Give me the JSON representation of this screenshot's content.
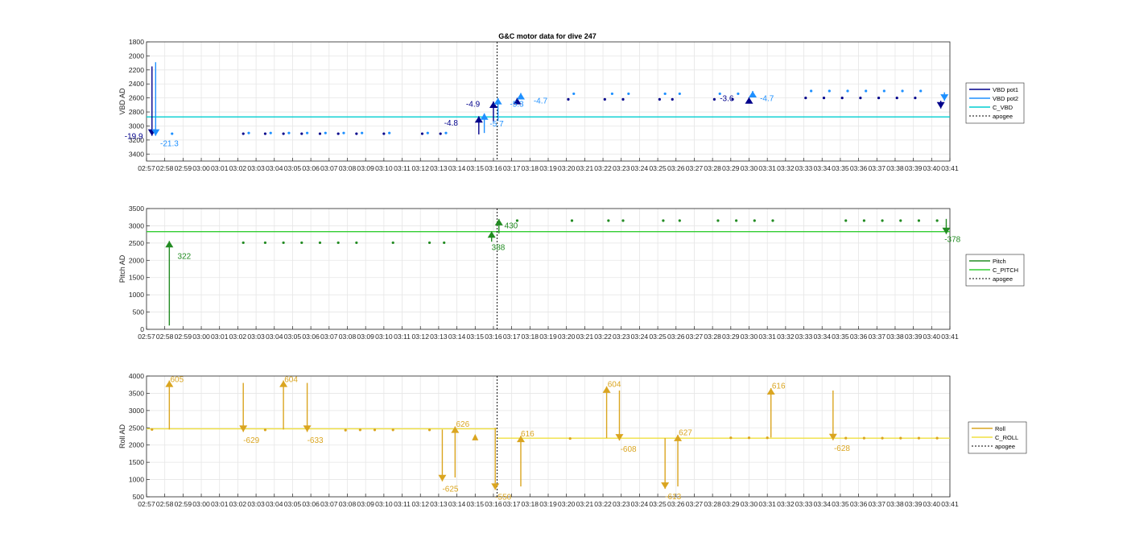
{
  "figure_title": "G&C motor data for dive 247",
  "time_ticks": [
    "02:57",
    "02:58",
    "02:59",
    "03:00",
    "03:01",
    "03:02",
    "03:03",
    "03:04",
    "03:05",
    "03:06",
    "03:07",
    "03:08",
    "03:09",
    "03:10",
    "03:11",
    "03:12",
    "03:13",
    "03:14",
    "03:15",
    "03:16",
    "03:17",
    "03:18",
    "03:19",
    "03:20",
    "03:21",
    "03:22",
    "03:23",
    "03:24",
    "03:25",
    "03:26",
    "03:27",
    "03:28",
    "03:29",
    "03:30",
    "03:31",
    "03:32",
    "03:33",
    "03:34",
    "03:35",
    "03:36",
    "03:37",
    "03:38",
    "03:39",
    "03:40",
    "03:41"
  ],
  "colors": {
    "vbd_pot1": "#00008b",
    "vbd_pot2": "#1e90ff",
    "c_vbd": "#00ced1",
    "pitch": "#228b22",
    "c_pitch": "#32cd32",
    "roll": "#daa520",
    "c_roll": "#f0e040",
    "apogee": "#000000",
    "grid": "#e6e6e6",
    "axis": "#262626"
  },
  "chart_data": [
    {
      "type": "line",
      "title": "G&C motor data for dive 247",
      "ylabel": "VBD AD",
      "xlabel": "",
      "ylim": [
        1800,
        3500
      ],
      "y_reversed": true,
      "yticks": [
        1800,
        2000,
        2200,
        2400,
        2600,
        2800,
        3000,
        3200,
        3400
      ],
      "xlim": [
        0,
        44
      ],
      "grid": true,
      "legend_position": "right",
      "legend": [
        "VBD pot1",
        "VBD pot2",
        "C_VBD",
        "apogee"
      ],
      "apogee_x": 19.2,
      "series": [
        {
          "name": "VBD pot1",
          "color": "#00008b",
          "marker_only": true,
          "x": [
            5.3,
            6.5,
            7.5,
            8.5,
            9.5,
            10.5,
            11.5,
            13.0,
            15.1,
            16.1,
            23.1,
            25.1,
            26.1,
            28.1,
            28.8,
            31.1,
            32.1,
            36.1,
            37.1,
            38.1,
            39.1,
            40.1,
            41.1,
            42.1
          ],
          "y": [
            3110,
            3110,
            3110,
            3110,
            3110,
            3110,
            3110,
            3110,
            3110,
            3110,
            2620,
            2620,
            2620,
            2620,
            2620,
            2620,
            2620,
            2600,
            2600,
            2600,
            2600,
            2600,
            2600,
            2600
          ]
        },
        {
          "name": "VBD pot2",
          "color": "#1e90ff",
          "marker_only": true,
          "x": [
            1.4,
            5.6,
            6.8,
            7.8,
            8.8,
            9.8,
            10.8,
            11.8,
            13.3,
            15.4,
            16.4,
            23.4,
            25.5,
            26.4,
            28.4,
            29.2,
            31.4,
            32.4,
            36.4,
            37.4,
            38.4,
            39.4,
            40.4,
            41.4,
            42.4
          ],
          "y": [
            3110,
            3100,
            3100,
            3100,
            3100,
            3100,
            3100,
            3100,
            3100,
            3100,
            3100,
            2540,
            2540,
            2540,
            2540,
            2540,
            2540,
            2540,
            2500,
            2500,
            2500,
            2500,
            2500,
            2500,
            2500
          ]
        },
        {
          "name": "C_VBD",
          "color": "#00ced1",
          "constant_y": 2870
        }
      ],
      "moves": [
        {
          "x": 0.3,
          "from": 2150,
          "to": 3140,
          "color": "#00008b"
        },
        {
          "x": 0.5,
          "from": 2090,
          "to": 3140,
          "color": "#1e90ff"
        },
        {
          "x": 18.2,
          "from": 3120,
          "to": 2860,
          "color": "#00008b"
        },
        {
          "x": 18.5,
          "from": 3100,
          "to": 2820,
          "color": "#1e90ff"
        },
        {
          "x": 19.0,
          "from": 2940,
          "to": 2650,
          "color": "#00008b"
        },
        {
          "x": 19.25,
          "from": 2930,
          "to": 2600,
          "color": "#1e90ff"
        },
        {
          "x": 20.3,
          "from": 2650,
          "to": 2600,
          "color": "#00008b"
        },
        {
          "x": 20.5,
          "from": 2600,
          "to": 2530,
          "color": "#1e90ff"
        },
        {
          "x": 33.0,
          "from": 2620,
          "to": 2590,
          "color": "#00008b"
        },
        {
          "x": 33.2,
          "from": 2560,
          "to": 2500,
          "color": "#1e90ff"
        },
        {
          "x": 43.5,
          "from": 2640,
          "to": 2750,
          "color": "#00008b"
        },
        {
          "x": 43.7,
          "from": 2520,
          "to": 2640,
          "color": "#1e90ff"
        }
      ],
      "annotations": [
        {
          "text": "-19.9",
          "x": -1.2,
          "y": 3140,
          "color": "#00008b"
        },
        {
          "text": "-21.3",
          "x": 0.75,
          "y": 3240,
          "color": "#1e90ff"
        },
        {
          "text": "-4.8",
          "x": 16.3,
          "y": 2950,
          "color": "#00008b"
        },
        {
          "text": "-5.7",
          "x": 18.8,
          "y": 2960,
          "color": "#1e90ff"
        },
        {
          "text": "-4.9",
          "x": 17.5,
          "y": 2680,
          "color": "#00008b"
        },
        {
          "text": "-5.3",
          "x": 19.9,
          "y": 2680,
          "color": "#1e90ff"
        },
        {
          "text": "-4.7",
          "x": 21.2,
          "y": 2630,
          "color": "#1e90ff"
        },
        {
          "text": "-3.6",
          "x": 31.4,
          "y": 2600,
          "color": "#00008b"
        },
        {
          "text": "-4.7",
          "x": 33.6,
          "y": 2600,
          "color": "#1e90ff"
        }
      ]
    },
    {
      "type": "line",
      "title": "",
      "ylabel": "Pitch AD",
      "xlabel": "",
      "ylim": [
        0,
        3500
      ],
      "yticks": [
        0,
        500,
        1000,
        1500,
        2000,
        2500,
        3000,
        3500
      ],
      "xlim": [
        0,
        44
      ],
      "grid": true,
      "legend_position": "right",
      "legend": [
        "Pitch",
        "C_PITCH",
        "apogee"
      ],
      "apogee_x": 19.2,
      "series": [
        {
          "name": "Pitch",
          "color": "#228b22",
          "marker_only": true,
          "x": [
            5.3,
            6.5,
            7.5,
            8.5,
            9.5,
            10.5,
            11.5,
            13.5,
            15.5,
            16.3,
            20.3,
            23.3,
            25.3,
            26.1,
            28.3,
            29.2,
            31.3,
            32.3,
            33.3,
            34.3,
            38.3,
            39.3,
            40.3,
            41.3,
            42.3,
            43.3
          ],
          "y": [
            2510,
            2510,
            2510,
            2510,
            2510,
            2510,
            2510,
            2510,
            2510,
            2510,
            3150,
            3150,
            3150,
            3150,
            3150,
            3150,
            3150,
            3150,
            3150,
            3150,
            3150,
            3150,
            3150,
            3150,
            3150,
            3150
          ]
        },
        {
          "name": "C_PITCH",
          "color": "#32cd32",
          "constant_y": 2830
        }
      ],
      "moves": [
        {
          "x": 1.25,
          "from": 110,
          "to": 2560,
          "color": "#228b22"
        },
        {
          "x": 18.9,
          "from": 2540,
          "to": 2840,
          "color": "#228b22"
        },
        {
          "x": 19.3,
          "from": 2780,
          "to": 3200,
          "color": "#228b22"
        },
        {
          "x": 43.8,
          "from": 3200,
          "to": 2760,
          "color": "#228b22"
        }
      ],
      "annotations": [
        {
          "text": "322",
          "x": 1.7,
          "y": 2130,
          "color": "#228b22"
        },
        {
          "text": "388",
          "x": 18.9,
          "y": 2390,
          "color": "#228b22"
        },
        {
          "text": "430",
          "x": 19.6,
          "y": 3020,
          "color": "#228b22"
        },
        {
          "text": "-378",
          "x": 43.7,
          "y": 2620,
          "color": "#228b22"
        }
      ]
    },
    {
      "type": "line",
      "title": "",
      "ylabel": "Roll AD",
      "xlabel": "",
      "ylim": [
        500,
        4000
      ],
      "yticks": [
        500,
        1000,
        1500,
        2000,
        2500,
        3000,
        3500,
        4000
      ],
      "xlim": [
        0,
        44
      ],
      "grid": true,
      "legend_position": "right",
      "legend": [
        "Roll",
        "C_ROLL",
        "apogee"
      ],
      "apogee_x": 19.2,
      "series": [
        {
          "name": "Roll",
          "color": "#daa520",
          "marker_only": true,
          "x": [
            0.3,
            6.5,
            10.9,
            11.7,
            12.5,
            13.5,
            15.5,
            23.2,
            32.0,
            33.0,
            34.0,
            38.3,
            39.3,
            40.3,
            41.3,
            42.3,
            43.3
          ],
          "y": [
            2450,
            2440,
            2430,
            2440,
            2440,
            2440,
            2440,
            2190,
            2210,
            2210,
            2210,
            2200,
            2200,
            2200,
            2200,
            2200,
            2200
          ]
        },
        {
          "name": "C_ROLL",
          "color": "#f0e040",
          "constant_y_segments": [
            {
              "x0": 0,
              "x1": 19.2,
              "y": 2470
            },
            {
              "x0": 19.2,
              "x1": 44,
              "y": 2200
            }
          ]
        }
      ],
      "moves": [
        {
          "x": 1.25,
          "from": 2450,
          "to": 3870,
          "color": "#daa520"
        },
        {
          "x": 5.3,
          "from": 3800,
          "to": 2380,
          "color": "#daa520"
        },
        {
          "x": 7.5,
          "from": 2450,
          "to": 3870,
          "color": "#daa520"
        },
        {
          "x": 8.8,
          "from": 3800,
          "to": 2380,
          "color": "#daa520"
        },
        {
          "x": 16.2,
          "from": 2450,
          "to": 950,
          "color": "#daa520"
        },
        {
          "x": 16.9,
          "from": 1060,
          "to": 2540,
          "color": "#daa520"
        },
        {
          "x": 19.1,
          "from": 2500,
          "to": 700,
          "color": "#daa520"
        },
        {
          "x": 20.5,
          "from": 800,
          "to": 2270,
          "color": "#daa520"
        },
        {
          "x": 25.2,
          "from": 2200,
          "to": 3700,
          "color": "#daa520"
        },
        {
          "x": 25.9,
          "from": 3580,
          "to": 2130,
          "color": "#daa520"
        },
        {
          "x": 28.4,
          "from": 2200,
          "to": 730,
          "color": "#daa520"
        },
        {
          "x": 29.1,
          "from": 800,
          "to": 2300,
          "color": "#daa520"
        },
        {
          "x": 34.2,
          "from": 2220,
          "to": 3650,
          "color": "#daa520"
        },
        {
          "x": 37.6,
          "from": 3580,
          "to": 2140,
          "color": "#daa520"
        }
      ],
      "extra_markers": [
        {
          "x": 18.0,
          "y": 2230,
          "color": "#daa520"
        }
      ],
      "annotations": [
        {
          "text": "605",
          "x": 1.3,
          "y": 3920,
          "color": "#daa520"
        },
        {
          "text": "-629",
          "x": 5.3,
          "y": 2160,
          "color": "#daa520"
        },
        {
          "text": "604",
          "x": 7.55,
          "y": 3920,
          "color": "#daa520"
        },
        {
          "text": "-633",
          "x": 8.8,
          "y": 2160,
          "color": "#daa520"
        },
        {
          "text": "-625",
          "x": 16.2,
          "y": 740,
          "color": "#daa520"
        },
        {
          "text": "626",
          "x": 16.95,
          "y": 2620,
          "color": "#daa520"
        },
        {
          "text": "-550",
          "x": 19.1,
          "y": 510,
          "color": "#daa520"
        },
        {
          "text": "616",
          "x": 20.5,
          "y": 2340,
          "color": "#daa520"
        },
        {
          "text": "604",
          "x": 25.25,
          "y": 3780,
          "color": "#daa520"
        },
        {
          "text": "-608",
          "x": 25.95,
          "y": 1900,
          "color": "#daa520"
        },
        {
          "text": "-613",
          "x": 28.4,
          "y": 520,
          "color": "#daa520"
        },
        {
          "text": "627",
          "x": 29.15,
          "y": 2380,
          "color": "#daa520"
        },
        {
          "text": "616",
          "x": 34.25,
          "y": 3730,
          "color": "#daa520"
        },
        {
          "text": "-628",
          "x": 37.65,
          "y": 1920,
          "color": "#daa520"
        }
      ]
    }
  ]
}
